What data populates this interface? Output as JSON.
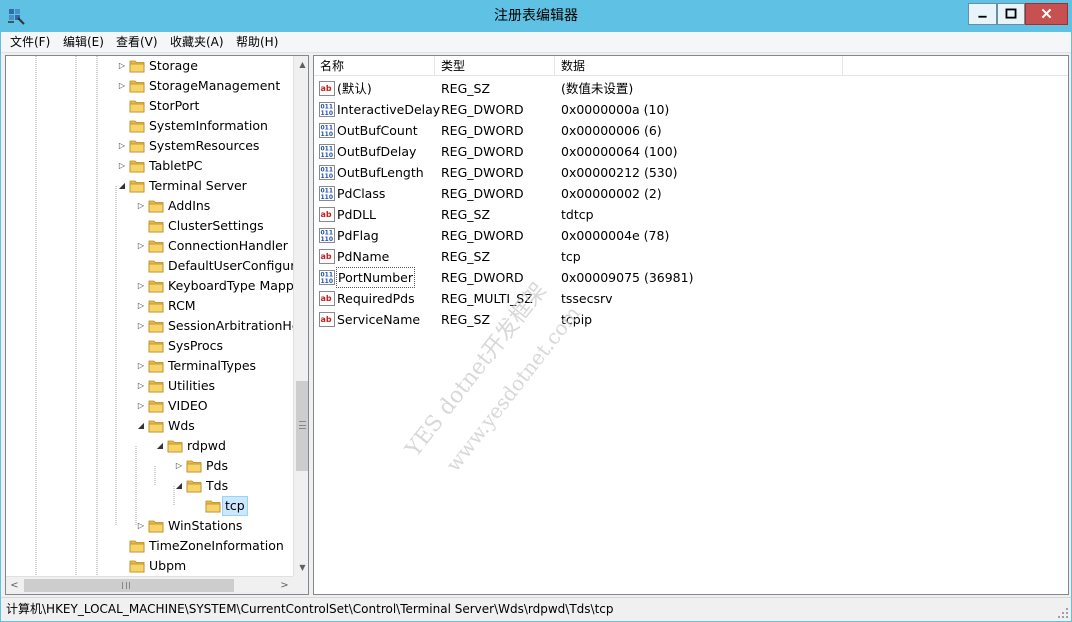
{
  "window": {
    "title": "注册表编辑器",
    "icon": "regedit-icon",
    "title_bar_color": "#5fc2e4",
    "close_color": "#c75050"
  },
  "menu": [
    "文件(F)",
    "编辑(E)",
    "查看(V)",
    "收藏夹(A)",
    "帮助(H)"
  ],
  "tree": {
    "items": [
      {
        "label": "Storage",
        "expander": "▷"
      },
      {
        "label": "StorageManagement",
        "expander": "▷"
      },
      {
        "label": "StorPort",
        "expander": ""
      },
      {
        "label": "SystemInformation",
        "expander": ""
      },
      {
        "label": "SystemResources",
        "expander": "▷"
      },
      {
        "label": "TabletPC",
        "expander": "▷"
      },
      {
        "label": "Terminal Server",
        "expander": "◢"
      },
      {
        "label": "AddIns",
        "expander": "▷"
      },
      {
        "label": "ClusterSettings",
        "expander": ""
      },
      {
        "label": "ConnectionHandler",
        "expander": "▷"
      },
      {
        "label": "DefaultUserConfigurat",
        "expander": ""
      },
      {
        "label": "KeyboardType Mappi",
        "expander": "▷"
      },
      {
        "label": "RCM",
        "expander": "▷"
      },
      {
        "label": "SessionArbitrationHelp",
        "expander": "▷"
      },
      {
        "label": "SysProcs",
        "expander": ""
      },
      {
        "label": "TerminalTypes",
        "expander": "▷"
      },
      {
        "label": "Utilities",
        "expander": "▷"
      },
      {
        "label": "VIDEO",
        "expander": "▷"
      },
      {
        "label": "Wds",
        "expander": "◢"
      },
      {
        "label": "rdpwd",
        "expander": "◢"
      },
      {
        "label": "Pds",
        "expander": "▷"
      },
      {
        "label": "Tds",
        "expander": "◢"
      },
      {
        "label": "tcp",
        "expander": ""
      },
      {
        "label": "WinStations",
        "expander": "▷"
      },
      {
        "label": "TimeZoneInformation",
        "expander": ""
      },
      {
        "label": "Ubpm",
        "expander": ""
      }
    ]
  },
  "list": {
    "columns": [
      "名称",
      "类型",
      "数据"
    ],
    "rows": [
      {
        "name": "(默认)",
        "type": "REG_SZ",
        "data": "(数值未设置)",
        "icon": "string-value-icon"
      },
      {
        "name": "InteractiveDelay",
        "type": "REG_DWORD",
        "data": "0x0000000a (10)",
        "icon": "binary-value-icon"
      },
      {
        "name": "OutBufCount",
        "type": "REG_DWORD",
        "data": "0x00000006 (6)",
        "icon": "binary-value-icon"
      },
      {
        "name": "OutBufDelay",
        "type": "REG_DWORD",
        "data": "0x00000064 (100)",
        "icon": "binary-value-icon"
      },
      {
        "name": "OutBufLength",
        "type": "REG_DWORD",
        "data": "0x00000212 (530)",
        "icon": "binary-value-icon"
      },
      {
        "name": "PdClass",
        "type": "REG_DWORD",
        "data": "0x00000002 (2)",
        "icon": "binary-value-icon"
      },
      {
        "name": "PdDLL",
        "type": "REG_SZ",
        "data": "tdtcp",
        "icon": "string-value-icon"
      },
      {
        "name": "PdFlag",
        "type": "REG_DWORD",
        "data": "0x0000004e (78)",
        "icon": "binary-value-icon"
      },
      {
        "name": "PdName",
        "type": "REG_SZ",
        "data": "tcp",
        "icon": "string-value-icon"
      },
      {
        "name": "PortNumber",
        "type": "REG_DWORD",
        "data": "0x00009075 (36981)",
        "icon": "binary-value-icon"
      },
      {
        "name": "RequiredPds",
        "type": "REG_MULTI_SZ",
        "data": "tssecsrv",
        "icon": "string-value-icon"
      },
      {
        "name": "ServiceName",
        "type": "REG_SZ",
        "data": "tcpip",
        "icon": "string-value-icon"
      }
    ]
  },
  "watermark": {
    "line1": "YES dotnet开发框架",
    "line2": "www.yesdotnet.com"
  },
  "status": {
    "path": "计算机\\HKEY_LOCAL_MACHINE\\SYSTEM\\CurrentControlSet\\Control\\Terminal Server\\Wds\\rdpwd\\Tds\\tcp"
  }
}
